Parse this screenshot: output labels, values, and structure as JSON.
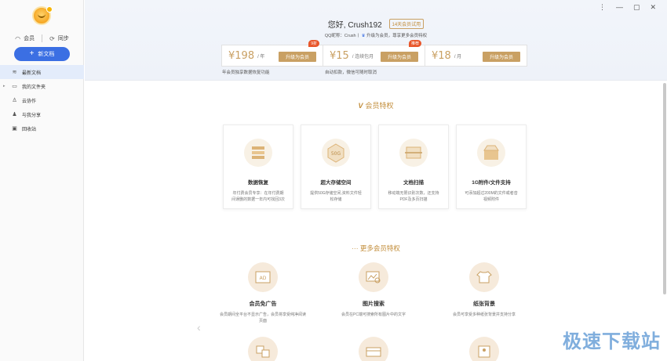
{
  "sidebar": {
    "vip_label": "会员",
    "sync_label": "同步",
    "new_doc_label": "新文档",
    "items": [
      {
        "label": "最新文档",
        "icon": "layers-icon"
      },
      {
        "label": "我的文件夹",
        "icon": "folder-icon"
      },
      {
        "label": "云协作",
        "icon": "person-icon"
      },
      {
        "label": "与我分享",
        "icon": "share-user-icon"
      },
      {
        "label": "回收站",
        "icon": "trash-icon"
      }
    ]
  },
  "window": {
    "controls": [
      "⋮",
      "—",
      "▢",
      "✕"
    ]
  },
  "header": {
    "greeting": "您好, Crush192",
    "trial_badge": "14天会员试用",
    "qq_text": "QQ昵称：Crush丨",
    "promo_text": "升级为会员，尊享更多会员特权"
  },
  "plans": [
    {
      "price": "¥198",
      "unit": "/ 年",
      "button": "升级为会员",
      "tag": "9折",
      "note": "年会员独享数据恢复功能"
    },
    {
      "price": "¥15",
      "unit": "/ 连续包月",
      "button": "升级为会员",
      "tag": "推荐",
      "note": "自动扣款，微信可随时取消"
    },
    {
      "price": "¥18",
      "unit": "/ 月",
      "button": "升级为会员",
      "tag": "",
      "note": ""
    }
  ],
  "privileges": {
    "title": "会员特权",
    "cards": [
      {
        "title": "数据恢复",
        "desc": "年付费会员专享：在年付费期间误删的数据一年内可找回3次",
        "icon": "database-icon"
      },
      {
        "title": "超大存储空间",
        "desc": "提供50G存储空间,资料文件轻松存储",
        "icon": "storage-50g-icon"
      },
      {
        "title": "文档扫描",
        "desc": "移动端无限识别次数，还支持PDF及多页扫描",
        "icon": "scan-icon"
      },
      {
        "title": "1G附件/文件支持",
        "desc": "可添加超过200M的文件或者音视频附件",
        "icon": "box-icon"
      }
    ]
  },
  "more": {
    "title": "更多会员特权",
    "features": [
      {
        "title": "会员免广告",
        "desc": "会员期间全平台不显示广告，会员将享受纯净阅读页面",
        "icon": "ad-icon"
      },
      {
        "title": "图片搜索",
        "desc": "会员在PC端可搜索所有图片中的文字",
        "icon": "image-search-icon"
      },
      {
        "title": "纸张背景",
        "desc": "会员可享受多种纸张背景并支持分享",
        "icon": "shirt-icon"
      },
      {
        "title": "",
        "desc": "",
        "icon": "translate-icon"
      },
      {
        "title": "",
        "desc": "",
        "icon": "card-icon"
      },
      {
        "title": "",
        "desc": "",
        "icon": "id-card-icon"
      }
    ]
  },
  "watermark": "极速下载站",
  "colors": {
    "accent": "#3b6fe3",
    "gold": "#c9a063",
    "tag": "#e8562a"
  }
}
